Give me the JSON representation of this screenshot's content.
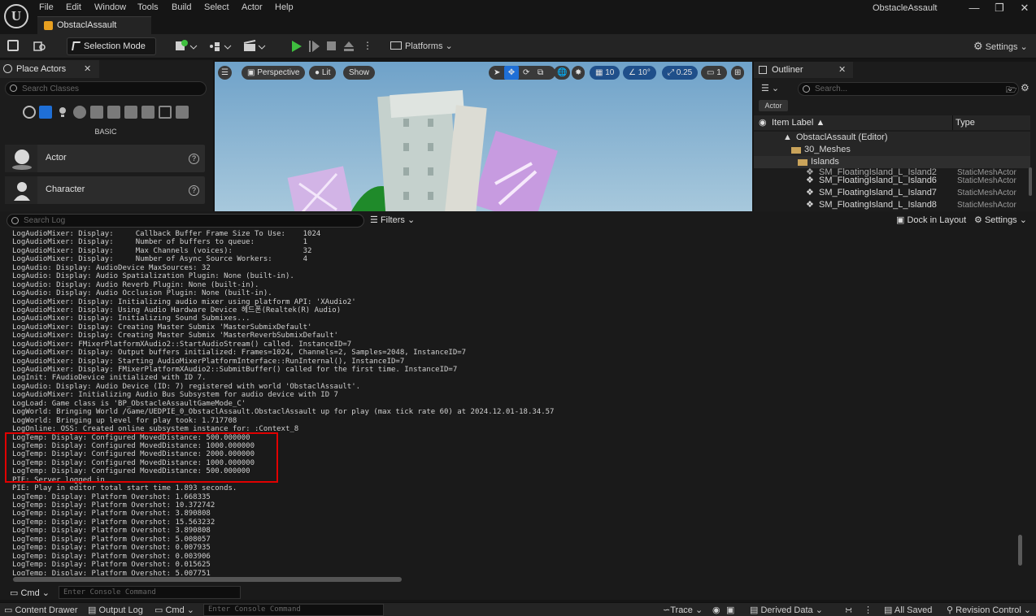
{
  "menu": [
    "File",
    "Edit",
    "Window",
    "Tools",
    "Build",
    "Select",
    "Actor",
    "Help"
  ],
  "project_tab": "ObstaclAssault",
  "window_title": "ObstacleAssault",
  "toolbar": {
    "selection_mode": "Selection Mode",
    "platforms": "Platforms",
    "settings": "Settings"
  },
  "place_actors": {
    "title": "Place Actors",
    "search_placeholder": "Search Classes",
    "category": "BASIC",
    "items": [
      "Actor",
      "Character"
    ]
  },
  "viewport": {
    "perspective": "Perspective",
    "lit": "Lit",
    "show": "Show",
    "grid": "10",
    "angle": "10°",
    "scale": "0.25",
    "camera": "1"
  },
  "outliner": {
    "title": "Outliner",
    "search_placeholder": "Search...",
    "filter_chip": "Actor",
    "col_label": "Item Label",
    "col_type": "Type",
    "rows": [
      {
        "label": "ObstaclAssault (Editor)",
        "type": ""
      },
      {
        "label": "30_Meshes",
        "type": ""
      },
      {
        "label": "Islands",
        "type": ""
      },
      {
        "label": "SM_FloatingIsland_L_Island2",
        "type": "StaticMeshActor"
      },
      {
        "label": "SM_FloatingIsland_L_Island6",
        "type": "StaticMeshActor"
      },
      {
        "label": "SM_FloatingIsland_L_Island7",
        "type": "StaticMeshActor"
      },
      {
        "label": "SM_FloatingIsland_L_Island8",
        "type": "StaticMeshActor"
      }
    ]
  },
  "log": {
    "search_placeholder": "Search Log",
    "filters": "Filters",
    "dock": "Dock in Layout",
    "settings": "Settings",
    "lines": [
      "LogAudioMixer: Display:     Callback Buffer Frame Size To Use:    1024",
      "LogAudioMixer: Display:     Number of buffers to queue:           1",
      "LogAudioMixer: Display:     Max Channels (voices):                32",
      "LogAudioMixer: Display:     Number of Async Source Workers:       4",
      "LogAudio: Display: AudioDevice MaxSources: 32",
      "LogAudio: Display: Audio Spatialization Plugin: None (built-in).",
      "LogAudio: Display: Audio Reverb Plugin: None (built-in).",
      "LogAudio: Display: Audio Occlusion Plugin: None (built-in).",
      "LogAudioMixer: Display: Initializing audio mixer using platform API: 'XAudio2'",
      "LogAudioMixer: Display: Using Audio Hardware Device 헤드폰(Realtek(R) Audio)",
      "LogAudioMixer: Display: Initializing Sound Submixes...",
      "LogAudioMixer: Display: Creating Master Submix 'MasterSubmixDefault'",
      "LogAudioMixer: Display: Creating Master Submix 'MasterReverbSubmixDefault'",
      "LogAudioMixer: FMixerPlatformXAudio2::StartAudioStream() called. InstanceID=7",
      "LogAudioMixer: Display: Output buffers initialized: Frames=1024, Channels=2, Samples=2048, InstanceID=7",
      "LogAudioMixer: Display: Starting AudioMixerPlatformInterface::RunInternal(), InstanceID=7",
      "LogAudioMixer: Display: FMixerPlatformXAudio2::SubmitBuffer() called for the first time. InstanceID=7",
      "LogInit: FAudioDevice initialized with ID 7.",
      "LogAudio: Display: Audio Device (ID: 7) registered with world 'ObstaclAssault'.",
      "LogAudioMixer: Initializing Audio Bus Subsystem for audio device with ID 7",
      "LogLoad: Game class is 'BP_ObstacleAssaultGameMode_C'",
      "LogWorld: Bringing World /Game/UEDPIE_0_ObstaclAssault.ObstaclAssault up for play (max tick rate 60) at 2024.12.01-18.34.57",
      "LogWorld: Bringing up level for play took: 1.717708",
      "LogOnline: OSS: Created online subsystem instance for: :Context_8",
      "LogTemp: Display: Configured MovedDistance: 500.000000",
      "LogTemp: Display: Configured MovedDistance: 1000.000000",
      "LogTemp: Display: Configured MovedDistance: 2000.000000",
      "LogTemp: Display: Configured MovedDistance: 1000.000000",
      "LogTemp: Display: Configured MovedDistance: 500.000000",
      "PIE: Server logged in",
      "PIE: Play in editor total start time 1.893 seconds.",
      "LogTemp: Display: Platform Overshot: 1.668335",
      "LogTemp: Display: Platform Overshot: 10.372742",
      "LogTemp: Display: Platform Overshot: 3.890808",
      "LogTemp: Display: Platform Overshot: 15.563232",
      "LogTemp: Display: Platform Overshot: 3.890808",
      "LogTemp: Display: Platform Overshot: 5.008057",
      "LogTemp: Display: Platform Overshot: 0.007935",
      "LogTemp: Display: Platform Overshot: 0.003906",
      "LogTemp: Display: Platform Overshot: 0.015625",
      "LogTemp: Display: Platform Overshot: 5.007751"
    ]
  },
  "console": {
    "cmd": "Cmd",
    "placeholder": "Enter Console Command"
  },
  "statusbar": {
    "content_drawer": "Content Drawer",
    "output_log": "Output Log",
    "cmd": "Cmd",
    "placeholder": "Enter Console Command",
    "trace": "Trace",
    "derived_data": "Derived Data",
    "all_saved": "All Saved",
    "revision_control": "Revision Control"
  },
  "colors": {
    "highlight": "#e00000",
    "play_green": "#3fbf3f",
    "accent_blue": "#1f6fd6"
  }
}
